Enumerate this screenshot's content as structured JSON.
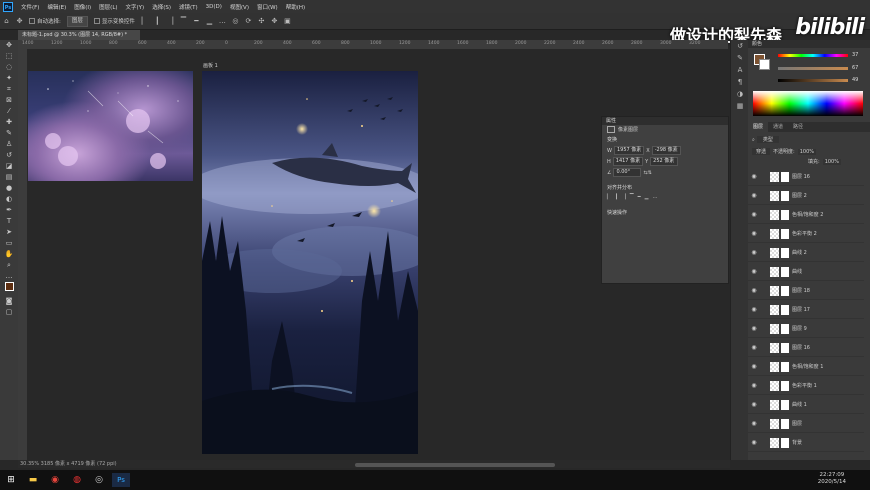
{
  "menubar": {
    "app_icon": "Ps",
    "items": [
      "文件(F)",
      "编辑(E)",
      "图像(I)",
      "图层(L)",
      "文字(Y)",
      "选择(S)",
      "滤镜(T)",
      "3D(D)",
      "视图(V)",
      "窗口(W)",
      "帮助(H)"
    ]
  },
  "optionsbar": {
    "auto_select_label": "自动选择:",
    "auto_select_value": "图层",
    "show_transform_label": "显示变换控件"
  },
  "watermark": {
    "text": "做设计的梨先森",
    "logo": "bilibili"
  },
  "document": {
    "tab_label": "未标题-1.psd @ 30.3% (图层 14, RGB/8#) *",
    "canvas_label": "画板 1"
  },
  "ruler_labels": [
    "1400",
    "1200",
    "1000",
    "800",
    "600",
    "400",
    "200",
    "0",
    "200",
    "400",
    "600",
    "800",
    "1000",
    "1200",
    "1400",
    "1600",
    "1800",
    "2000",
    "2200",
    "2400",
    "2600",
    "2800",
    "3000",
    "3200"
  ],
  "properties": {
    "header": "属性",
    "tab_label": "像素图层",
    "transform_label": "变换",
    "w_label": "W",
    "w_value": "1957 像素",
    "x_label": "X",
    "x_value": "-298 像素",
    "h_label": "H",
    "h_value": "1417 像素",
    "y_label": "Y",
    "y_value": "252 像素",
    "angle_value": "0.00°",
    "align_label": "对齐并分布",
    "quick_actions_label": "快速操作"
  },
  "color_panel": {
    "header": "颜色",
    "h_value": "37",
    "s_value": "67",
    "b_value": "49"
  },
  "layers_panel": {
    "tabs": [
      "图层",
      "通道",
      "路径"
    ],
    "filter_label": "类型",
    "blend_mode": "穿透",
    "opacity_label": "不透明度:",
    "opacity_value": "100%",
    "fill_label": "填充:",
    "fill_value": "100%",
    "layers": [
      {
        "name": "图层 16"
      },
      {
        "name": "图层 2"
      },
      {
        "name": "色相/饱和度 2"
      },
      {
        "name": "色彩平衡 2"
      },
      {
        "name": "曲线 2"
      },
      {
        "name": "曲线"
      },
      {
        "name": "图层 18"
      },
      {
        "name": "图层 17"
      },
      {
        "name": "图层 9"
      },
      {
        "name": "图层 16"
      },
      {
        "name": "色相/饱和度 1"
      },
      {
        "name": "色彩平衡 1"
      },
      {
        "name": "曲线 1"
      },
      {
        "name": "图层"
      },
      {
        "name": "背景"
      }
    ]
  },
  "statusbar": {
    "text": "30.35%    3185 像素 x 4719 像素 (72 ppi)"
  },
  "taskbar": {
    "time": "22:27:09",
    "date": "2020/5/14"
  },
  "colors": {
    "accent": "#31a8ff",
    "panel_bg": "#3a3a3a"
  }
}
